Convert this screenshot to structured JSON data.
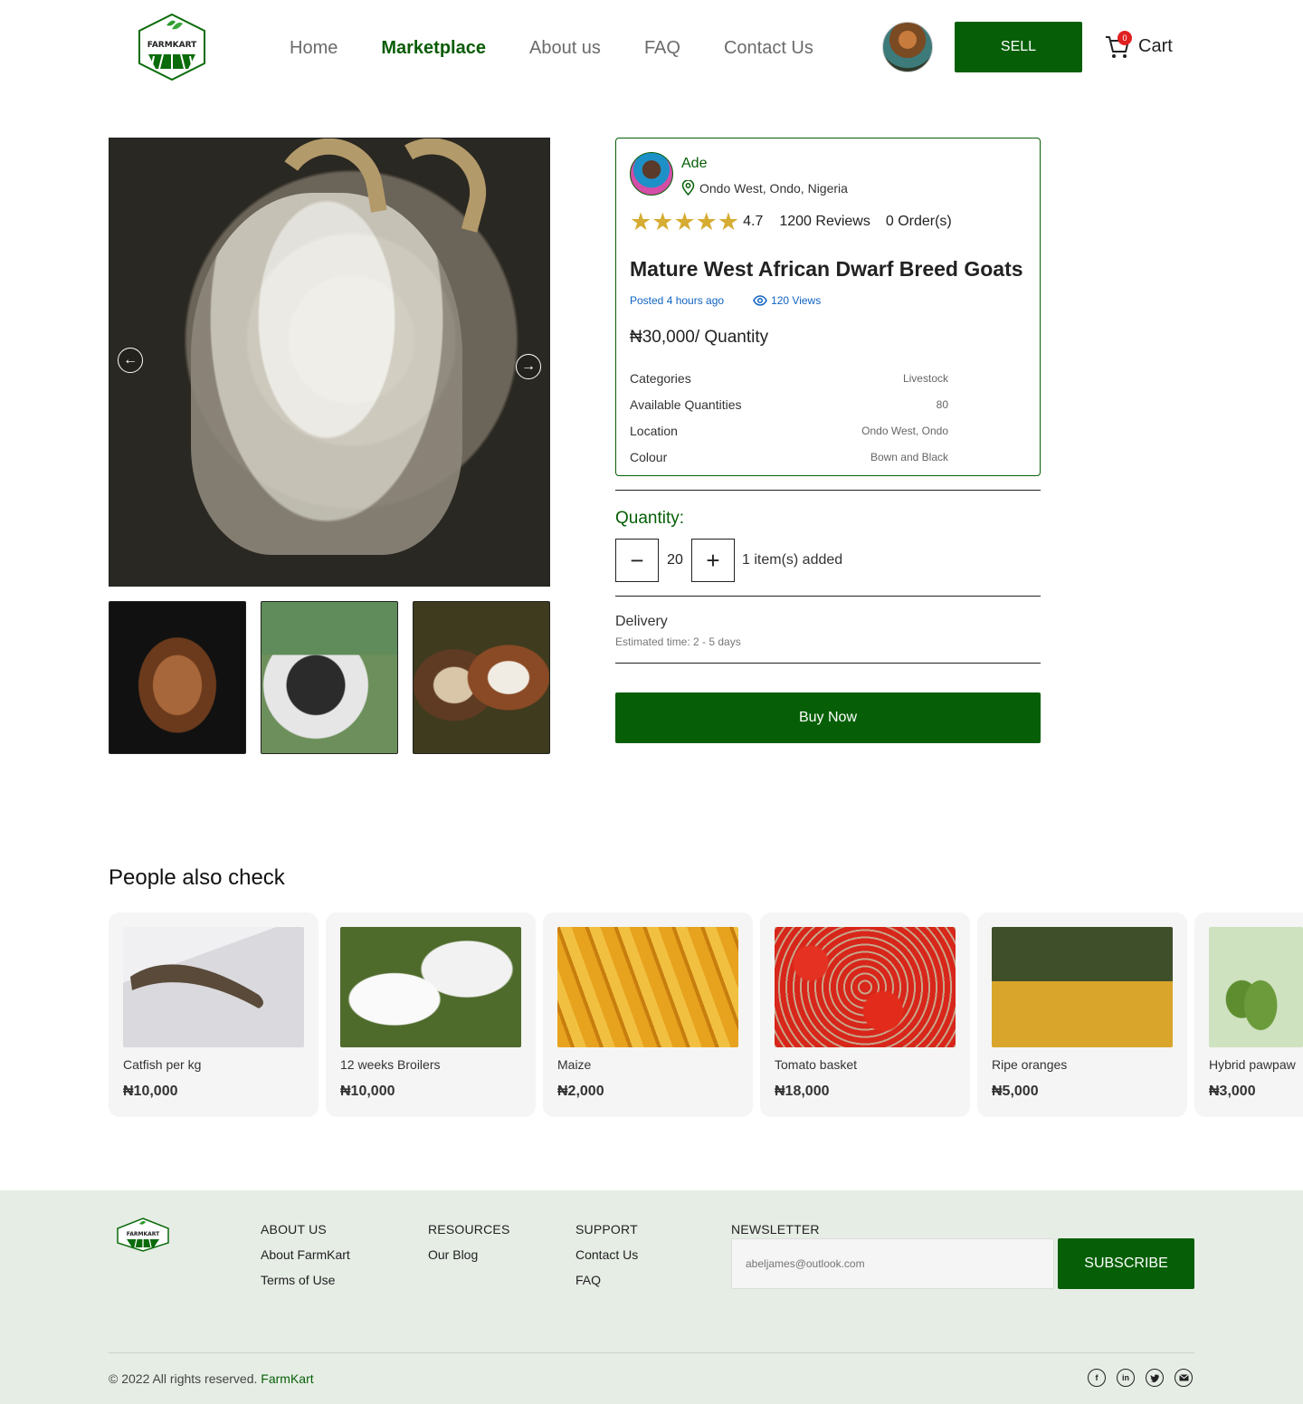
{
  "header": {
    "logo_text": "FARMKART",
    "nav": [
      {
        "label": "Home",
        "active": false
      },
      {
        "label": "Marketplace",
        "active": true
      },
      {
        "label": "About us",
        "active": false
      },
      {
        "label": "FAQ",
        "active": false
      },
      {
        "label": "Contact Us",
        "active": false
      }
    ],
    "sell_label": "SELL",
    "cart_label": "Cart",
    "cart_count": "0"
  },
  "seller": {
    "name": "Ade",
    "location": "Ondo West, Ondo, Nigeria",
    "rating": "4.7",
    "stars": 5,
    "reviews": "1200 Reviews",
    "orders": "0 Order(s)"
  },
  "product": {
    "title": "Mature West African Dwarf Breed Goats",
    "posted": "Posted 4 hours ago",
    "views": "120 Views",
    "price": "₦30,000/ Quantity",
    "specs": [
      {
        "label": "Categories",
        "value": "Livestock"
      },
      {
        "label": "Available Quantities",
        "value": "80"
      },
      {
        "label": "Location",
        "value": "Ondo West, Ondo"
      },
      {
        "label": "Colour",
        "value": "Bown and Black"
      }
    ]
  },
  "quantity": {
    "label": "Quantity:",
    "value": "20",
    "added": "1 item(s) added"
  },
  "delivery": {
    "title": "Delivery",
    "estimate": "Estimated time: 2 - 5 days"
  },
  "buy_label": "Buy Now",
  "related": {
    "title": "People also check",
    "items": [
      {
        "name": "Catfish per kg",
        "price": "₦10,000"
      },
      {
        "name": "12 weeks Broilers",
        "price": "₦10,000"
      },
      {
        "name": "Maize",
        "price": "₦2,000"
      },
      {
        "name": "Tomato basket",
        "price": "₦18,000"
      },
      {
        "name": "Ripe oranges",
        "price": "₦5,000"
      },
      {
        "name": "Hybrid pawpaw",
        "price": "₦3,000"
      }
    ]
  },
  "footer": {
    "logo_text": "FARMKART",
    "about": {
      "title": "ABOUT US",
      "links": [
        "About FarmKart",
        "Terms of Use"
      ]
    },
    "resources": {
      "title": "RESOURCES",
      "links": [
        "Our Blog"
      ]
    },
    "support": {
      "title": "SUPPORT",
      "links": [
        "Contact Us",
        "FAQ"
      ]
    },
    "newsletter": {
      "title": "NEWSLETTER",
      "placeholder": "abeljames@outlook.com",
      "button": "SUBSCRIBE"
    },
    "copyright": "© 2022 All rights reserved.",
    "brand": "FarmKart",
    "socials": [
      "facebook-icon",
      "linkedin-icon",
      "twitter-icon",
      "mail-icon"
    ]
  },
  "colors": {
    "brand_green": "#065f06",
    "star": "#d6ac32",
    "link_blue": "#1063c2",
    "footer_bg": "#e6ede5"
  }
}
